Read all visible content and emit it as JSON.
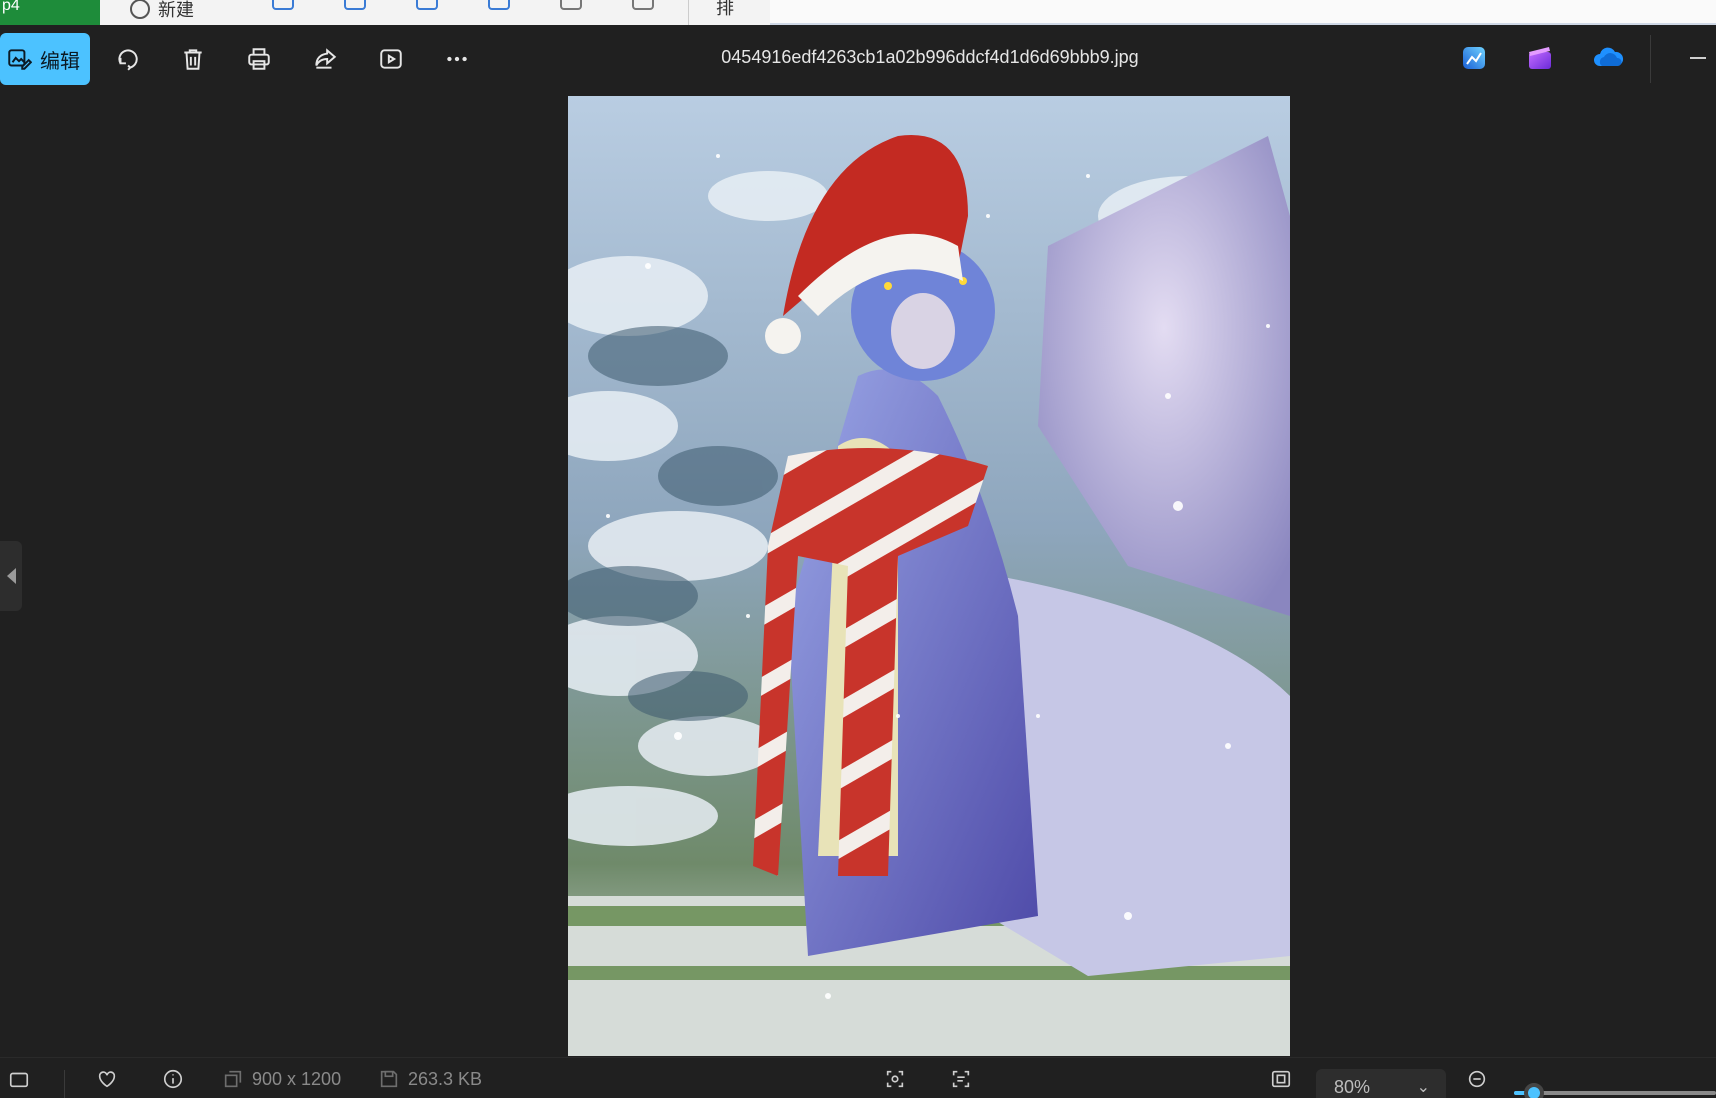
{
  "background_window": {
    "left_text": "p4",
    "new_label": "新建",
    "sort_label": "排"
  },
  "toolbar": {
    "edit_label": "编辑",
    "file_name": "0454916edf4263cb1a02b996ddcf4d1d6d69bbb9.jpg"
  },
  "icons": {
    "rotate": "rotate-icon",
    "delete": "trash-icon",
    "print": "print-icon",
    "share": "share-icon",
    "slideshow": "slideshow-icon",
    "more": "more-icon",
    "designer": "designer-app-icon",
    "clipchamp": "clipchamp-app-icon",
    "onedrive": "onedrive-cloud-icon"
  },
  "status": {
    "dimensions": "900 x 1200",
    "file_size": "263.3 KB",
    "zoom": "80%",
    "zoom_fraction": 0.1
  },
  "colors": {
    "accent": "#4cc2ff",
    "background": "#202020"
  }
}
